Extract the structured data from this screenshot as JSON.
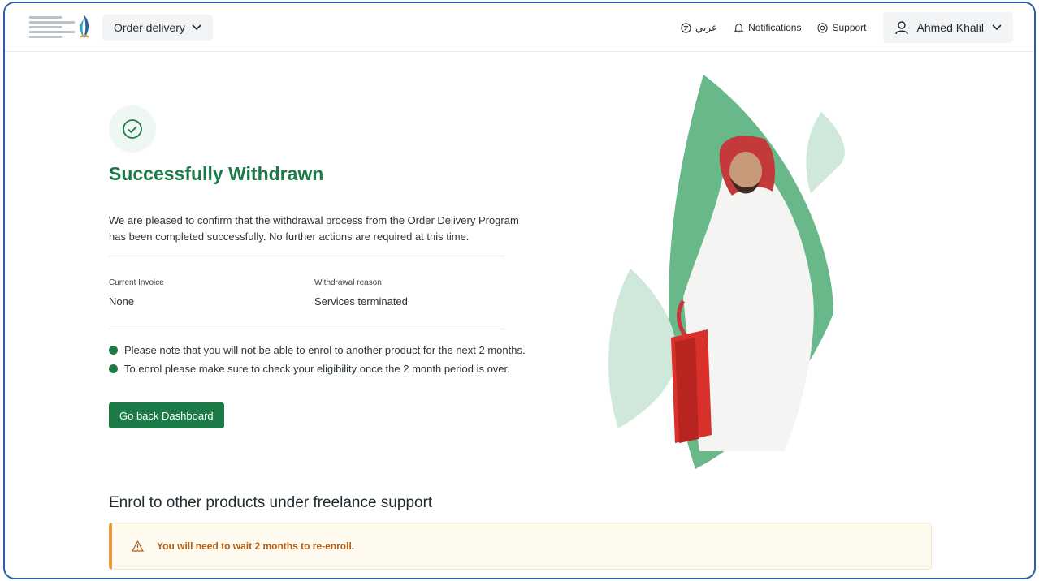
{
  "header": {
    "logo_alt": "Human Resources Development Fund",
    "menu_label": "Order delivery",
    "language_label": "عربي",
    "notifications_label": "Notifications",
    "support_label": "Support",
    "user_name": "Ahmed Khalil"
  },
  "main": {
    "title": "Successfully Withdrawn",
    "description": "We are pleased to confirm that the withdrawal process from the Order Delivery Program has been completed successfully. No further actions are required at this time.",
    "details": [
      {
        "label": "Current Invoice",
        "value": "None"
      },
      {
        "label": "Withdrawal reason",
        "value": "Services terminated"
      }
    ],
    "notes": [
      "Please note that you will not be able to enrol to another product for the next 2 months.",
      "To enrol please make sure to check your eligibility once the 2 month period is over."
    ],
    "back_button": "Go back Dashboard"
  },
  "products": {
    "section_title": "Enrol to other products under freelance support",
    "alert_text": "You will need to wait 2 months to re-enroll."
  },
  "colors": {
    "primary": "#1b7a45",
    "warning": "#e69a3a",
    "leaf": "#68b88a",
    "leaf_light": "#cfe8da"
  }
}
